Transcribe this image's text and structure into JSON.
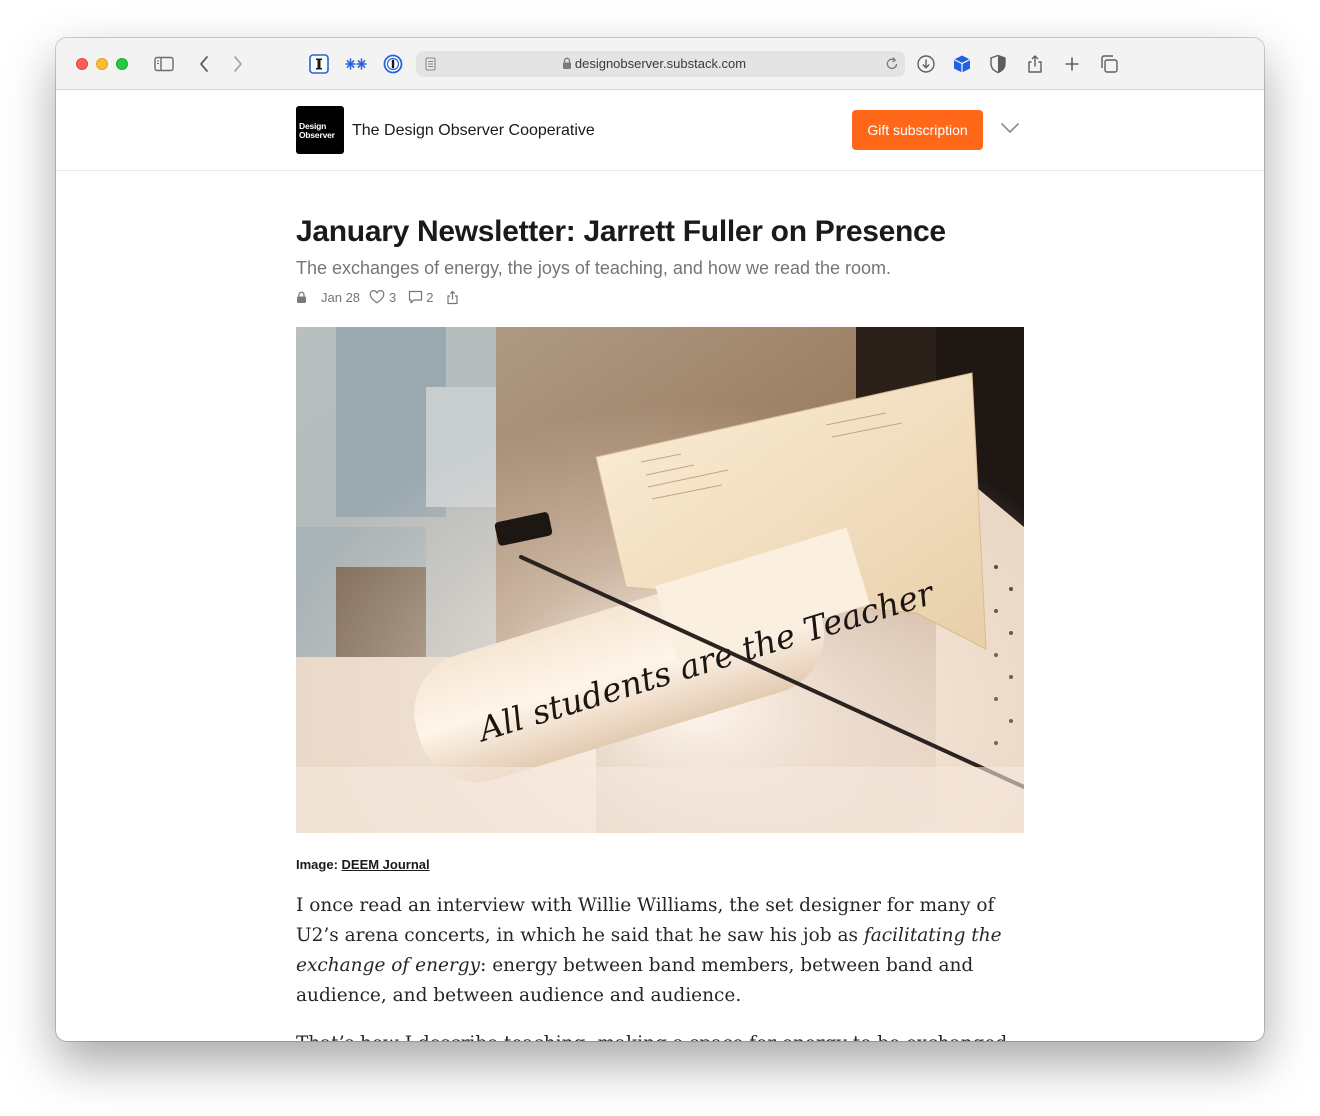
{
  "browser": {
    "url": "designobserver.substack.com",
    "icons": [
      "sidebar-icon",
      "back-icon",
      "forward-icon",
      "instapaper-icon",
      "extension-icon",
      "1password-icon",
      "page-icon",
      "lock-icon",
      "reload-icon",
      "download-icon",
      "cube-icon",
      "shield-icon",
      "share-icon",
      "new-tab-icon",
      "tabs-overview-icon"
    ]
  },
  "header": {
    "logo_line1": "Design",
    "logo_line2": "Observer",
    "publication": "The Design Observer Cooperative",
    "gift_button": "Gift subscription"
  },
  "article": {
    "title": "January Newsletter: Jarrett Fuller on Presence",
    "subtitle": "The exchanges of energy, the joys of teaching, and how we read the room.",
    "date": "Jan 28",
    "likes": "3",
    "comments": "2",
    "image_text": "All students are the Teacher",
    "caption_prefix": "Image: ",
    "caption_link": "DEEM Journal",
    "p1_a": "I once read an interview with Willie Williams, the set designer for many of U2’s arena concerts, in which he said that he saw his job as ",
    "p1_em": "facilitating the exchange of energy",
    "p1_b": ": energy between band members, between band and audience, and between audience and audience.",
    "p2": "That’s how I describe teaching: making a space for energy to be exchanged."
  },
  "colors": {
    "accent": "#ff6719",
    "title": "#1a1a1a",
    "muted": "#757575"
  }
}
